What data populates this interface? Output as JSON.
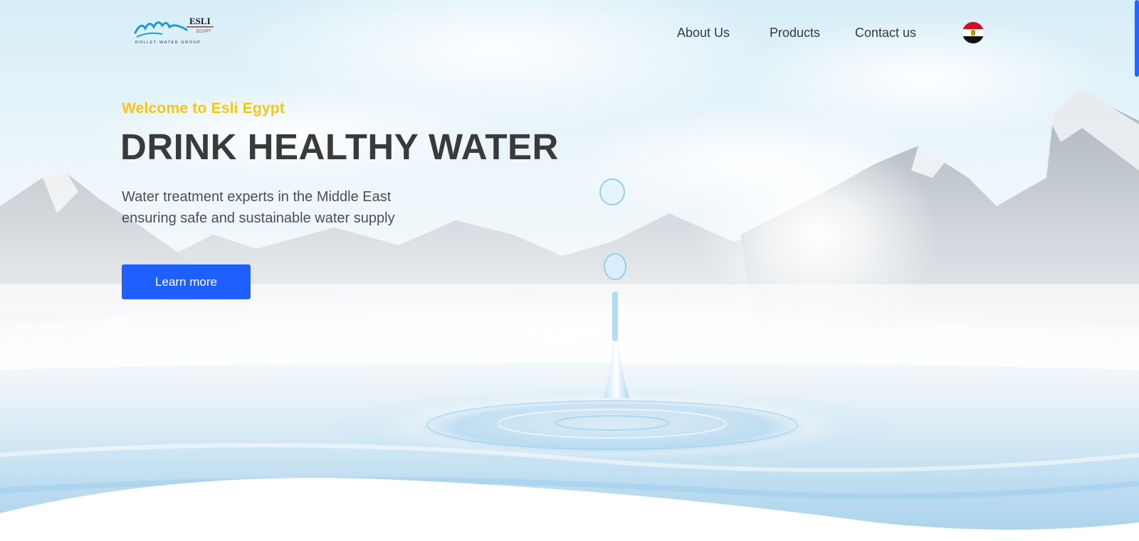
{
  "header": {
    "logo": {
      "wordmark": "ESLI",
      "sub": "EGYPT",
      "tagline": "ROLLET WATER GROUP"
    },
    "nav": [
      {
        "label": "About Us"
      },
      {
        "label": "Products"
      },
      {
        "label": "Contact us"
      }
    ],
    "language_flag": "egypt-flag-icon"
  },
  "hero": {
    "kicker": "Welcome to Esli Egypt",
    "headline": "DRINK HEALTHY WATER",
    "subtitle_lines": [
      "Water treatment experts in the Middle East",
      "ensuring safe and sustainable water supply"
    ],
    "cta_label": "Learn more"
  },
  "colors": {
    "accent": "#1f5fff",
    "kicker": "#f5c518",
    "headline": "#3a3a3a"
  }
}
